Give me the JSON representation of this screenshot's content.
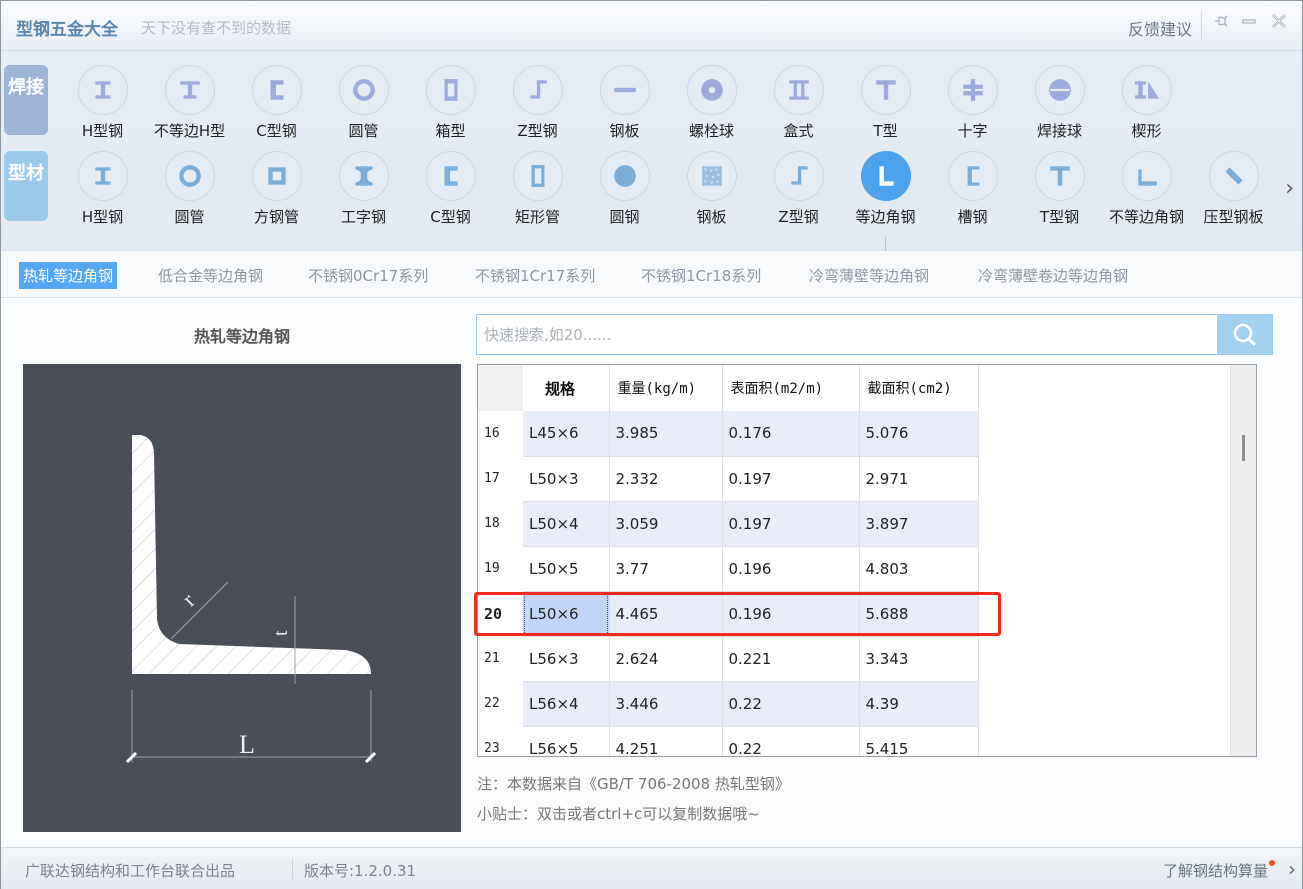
{
  "titlebar": {
    "title": "型钢五金大全",
    "slogan": "天下没有查不到的数据",
    "feedback": "反馈建议",
    "pin_icon": "pin-icon",
    "min_icon": "minimize-icon",
    "close_icon": "close-icon"
  },
  "side_tabs": {
    "weld": "焊接",
    "profile": "型材"
  },
  "weld_items": [
    {
      "label": "H型钢",
      "icon": "h-beam-icon"
    },
    {
      "label": "不等边H型",
      "icon": "unequal-h-icon"
    },
    {
      "label": "C型钢",
      "icon": "c-channel-icon"
    },
    {
      "label": "圆管",
      "icon": "round-pipe-icon"
    },
    {
      "label": "箱型",
      "icon": "box-section-icon"
    },
    {
      "label": "Z型钢",
      "icon": "z-section-icon"
    },
    {
      "label": "钢板",
      "icon": "plate-icon"
    },
    {
      "label": "螺栓球",
      "icon": "bolt-ball-icon"
    },
    {
      "label": "盒式",
      "icon": "box-type-icon"
    },
    {
      "label": "T型",
      "icon": "t-section-icon"
    },
    {
      "label": "十字",
      "icon": "cross-section-icon"
    },
    {
      "label": "焊接球",
      "icon": "welded-ball-icon"
    },
    {
      "label": "楔形",
      "icon": "wedge-icon"
    }
  ],
  "profile_items": [
    {
      "label": "H型钢",
      "icon": "h-beam-icon"
    },
    {
      "label": "圆管",
      "icon": "round-pipe-icon"
    },
    {
      "label": "方钢管",
      "icon": "square-tube-icon"
    },
    {
      "label": "工字钢",
      "icon": "i-beam-icon"
    },
    {
      "label": "C型钢",
      "icon": "c-channel-icon"
    },
    {
      "label": "矩形管",
      "icon": "rect-tube-icon"
    },
    {
      "label": "圆钢",
      "icon": "round-bar-icon"
    },
    {
      "label": "钢板",
      "icon": "plate-icon"
    },
    {
      "label": "Z型钢",
      "icon": "z-section-icon"
    },
    {
      "label": "等边角钢",
      "icon": "equal-angle-icon",
      "active": true
    },
    {
      "label": "槽钢",
      "icon": "channel-icon"
    },
    {
      "label": "T型钢",
      "icon": "t-section-icon"
    },
    {
      "label": "不等边角钢",
      "icon": "unequal-angle-icon"
    },
    {
      "label": "压型钢板",
      "icon": "profiled-sheet-icon"
    }
  ],
  "sub_tabs": [
    {
      "label": "热轧等边角钢",
      "active": true
    },
    {
      "label": "低合金等边角钢"
    },
    {
      "label": "不锈钢0Cr17系列"
    },
    {
      "label": "不锈钢1Cr17系列"
    },
    {
      "label": "不锈钢1Cr18系列"
    },
    {
      "label": "冷弯薄壁等边角钢"
    },
    {
      "label": "冷弯薄壁卷边等边角钢"
    }
  ],
  "diagram": {
    "title": "热轧等边角钢",
    "label_r": "r",
    "label_t": "t",
    "label_L": "L"
  },
  "search": {
    "placeholder": "快速搜索,如20......",
    "value": ""
  },
  "table": {
    "columns": [
      "规格",
      "重量(kg/m)",
      "表面积(m2/m)",
      "截面积(cm2)"
    ],
    "rows": [
      {
        "n": "16",
        "spec": "L45×6",
        "weight": "3.985",
        "surface": "0.176",
        "area": "5.076"
      },
      {
        "n": "17",
        "spec": "L50×3",
        "weight": "2.332",
        "surface": "0.197",
        "area": "2.971"
      },
      {
        "n": "18",
        "spec": "L50×4",
        "weight": "3.059",
        "surface": "0.197",
        "area": "3.897"
      },
      {
        "n": "19",
        "spec": "L50×5",
        "weight": "3.77",
        "surface": "0.196",
        "area": "4.803"
      },
      {
        "n": "20",
        "spec": "L50×6",
        "weight": "4.465",
        "surface": "0.196",
        "area": "5.688"
      },
      {
        "n": "21",
        "spec": "L56×3",
        "weight": "2.624",
        "surface": "0.221",
        "area": "3.343"
      },
      {
        "n": "22",
        "spec": "L56×4",
        "weight": "3.446",
        "surface": "0.22",
        "area": "4.39"
      },
      {
        "n": "23",
        "spec": "L56×5",
        "weight": "4.251",
        "surface": "0.22",
        "area": "5.415"
      }
    ],
    "selected_row": "20"
  },
  "notes": {
    "source": "注：本数据来自《GB/T  706-2008  热轧型钢》",
    "tip": "小贴士：双击或者ctrl+c可以复制数据哦~"
  },
  "statusbar": {
    "credit": "广联达钢结构和工作台联合出品",
    "version": "版本号:1.2.0.31",
    "learn_more": "了解钢结构算量"
  },
  "colors": {
    "accent": "#55a7f2",
    "highlight": "#f0281e",
    "selected_cell": "#c1d6f8"
  }
}
